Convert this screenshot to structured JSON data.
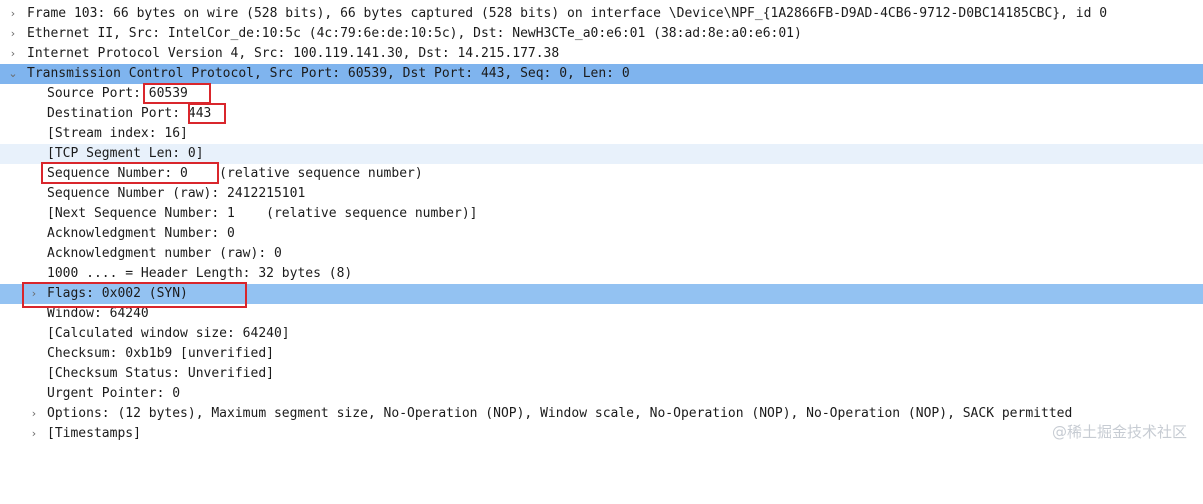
{
  "packet_details": {
    "frame": "Frame 103: 66 bytes on wire (528 bits), 66 bytes captured (528 bits) on interface \\Device\\NPF_{1A2866FB-D9AD-4CB6-9712-D0BC14185CBC}, id 0",
    "ethernet": "Ethernet II, Src: IntelCor_de:10:5c (4c:79:6e:de:10:5c), Dst: NewH3CTe_a0:e6:01 (38:ad:8e:a0:e6:01)",
    "ip": "Internet Protocol Version 4, Src: 100.119.141.30, Dst: 14.215.177.38",
    "tcp": "Transmission Control Protocol, Src Port: 60539, Dst Port: 443, Seq: 0, Len: 0",
    "tcp_fields": {
      "source_port_label": "Source Port: ",
      "source_port_value": "60539",
      "destination_port_label": "Destination Port: ",
      "destination_port_value": "443",
      "stream_index": "[Stream index: 16]",
      "segment_len": "[TCP Segment Len: 0]",
      "sequence_number": "Sequence Number: 0    (relative sequence number)",
      "sequence_number_raw": "Sequence Number (raw): 2412215101",
      "next_sequence_number": "[Next Sequence Number: 1    (relative sequence number)]",
      "ack_number": "Acknowledgment Number: 0",
      "ack_number_raw": "Acknowledgment number (raw): 0",
      "header_length": "1000 .... = Header Length: 32 bytes (8)",
      "flags": "Flags: 0x002 (SYN)",
      "window": "Window: 64240",
      "calc_window": "[Calculated window size: 64240]",
      "checksum": "Checksum: 0xb1b9 [unverified]",
      "checksum_status": "[Checksum Status: Unverified]",
      "urgent_pointer": "Urgent Pointer: 0",
      "options": "Options: (12 bytes), Maximum segment size, No-Operation (NOP), Window scale, No-Operation (NOP), No-Operation (NOP), SACK permitted",
      "timestamps": "[Timestamps]"
    }
  },
  "icons": {
    "collapsed": "chevron-right-icon",
    "expanded": "chevron-down-icon"
  },
  "glyphs": {
    "collapsed": "›",
    "expanded": "⌄"
  },
  "colors": {
    "selected_row": "#7fb4ee",
    "alt_row": "#e8f1fb",
    "highlight_box": "#d9262c",
    "watermark": "#c7ccd3"
  },
  "watermark": "@稀土掘金技术社区"
}
